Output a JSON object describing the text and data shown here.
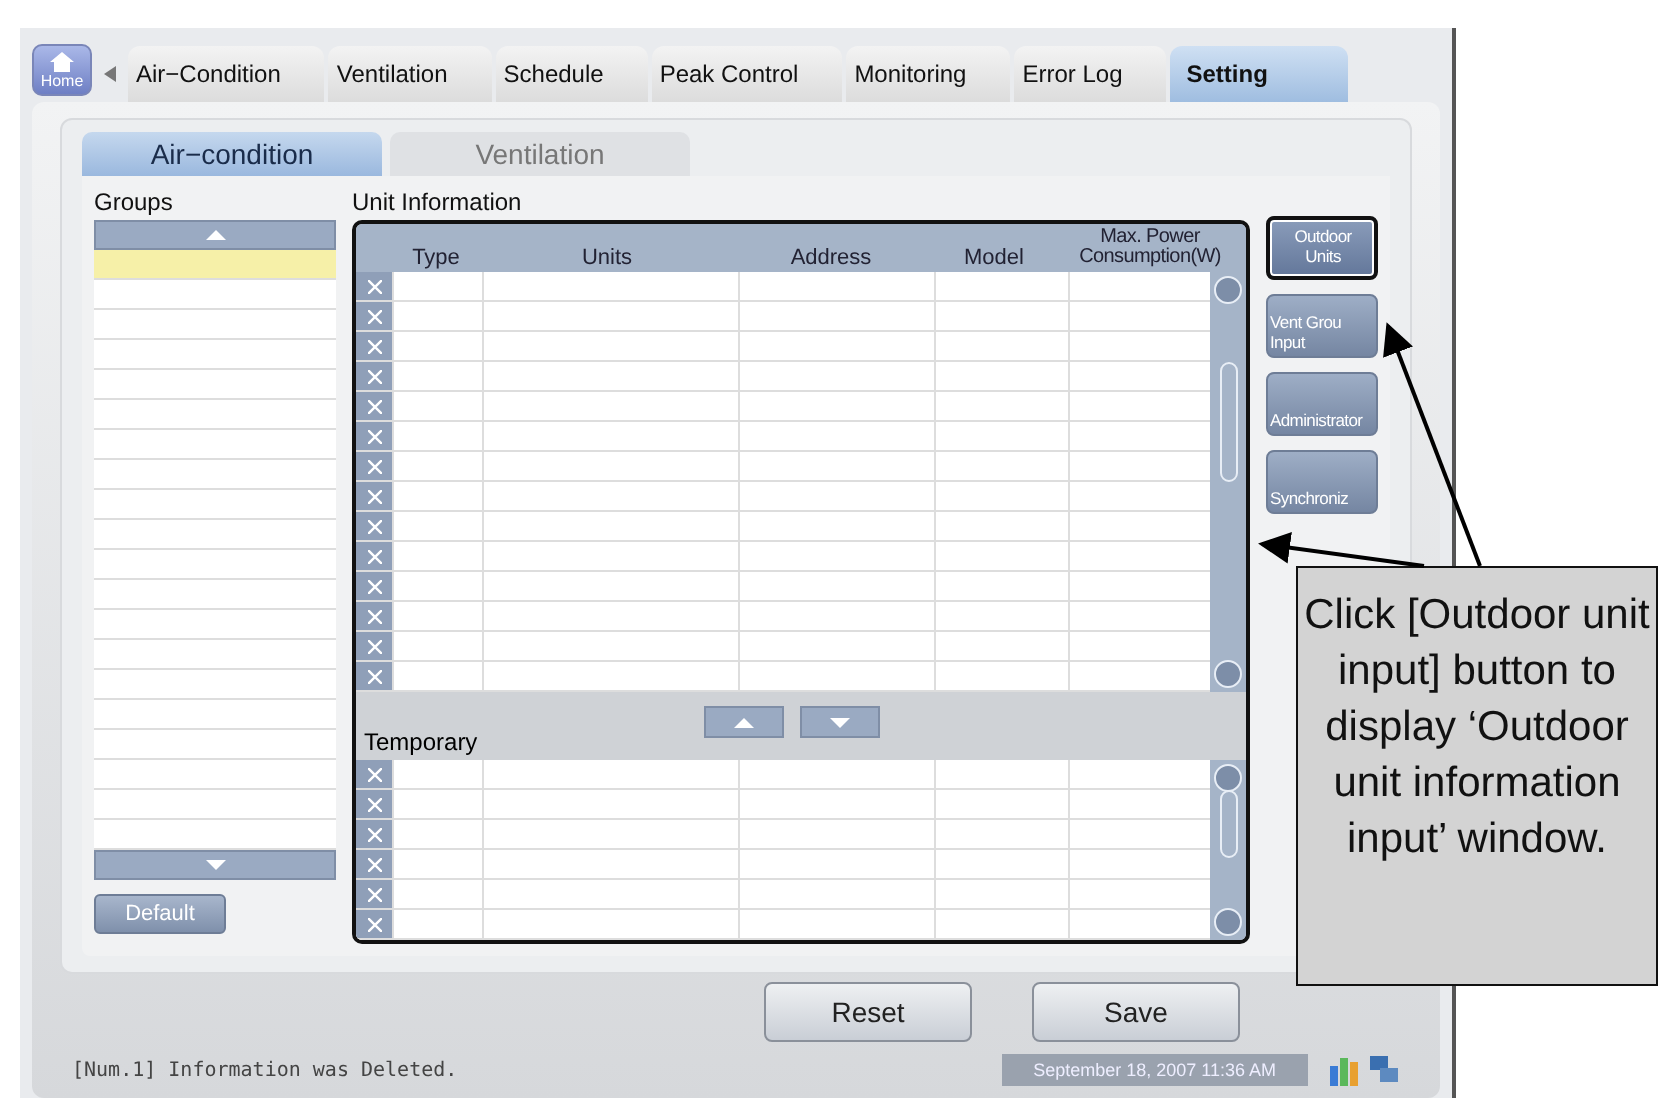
{
  "tabs": [
    {
      "label": "Home",
      "kind": "home",
      "selected": false
    },
    {
      "label": "Air−Condition",
      "kind": "tab",
      "selected": false
    },
    {
      "label": "Ventilation",
      "kind": "tab",
      "selected": false
    },
    {
      "label": "Schedule",
      "kind": "tab",
      "selected": false
    },
    {
      "label": "Peak Control",
      "kind": "tab",
      "selected": false
    },
    {
      "label": "Monitoring",
      "kind": "tab",
      "selected": false
    },
    {
      "label": "Error Log",
      "kind": "tab",
      "selected": false
    },
    {
      "label": "Setting",
      "kind": "tab",
      "selected": true
    }
  ],
  "subtabs": [
    {
      "label": "Air−condition",
      "selected": true
    },
    {
      "label": "Ventilation",
      "selected": false
    }
  ],
  "groups": {
    "title": "Groups",
    "button": "Default",
    "rows": [
      {
        "selected": true
      },
      {
        "selected": false
      },
      {
        "selected": false
      },
      {
        "selected": false
      },
      {
        "selected": false
      },
      {
        "selected": false
      },
      {
        "selected": false
      },
      {
        "selected": false
      },
      {
        "selected": false
      },
      {
        "selected": false
      },
      {
        "selected": false
      },
      {
        "selected": false
      },
      {
        "selected": false
      },
      {
        "selected": false
      },
      {
        "selected": false
      },
      {
        "selected": false
      },
      {
        "selected": false
      },
      {
        "selected": false
      },
      {
        "selected": false
      },
      {
        "selected": false
      }
    ]
  },
  "unit_information": {
    "title": "Unit Information",
    "columns": [
      "Type",
      "Units",
      "Address",
      "Model",
      "Max. Power Consumption(W)"
    ],
    "temporary_label": "Temporary"
  },
  "side_buttons": [
    {
      "lines": [
        "Outdoor",
        "Units"
      ],
      "highlighted": true
    },
    {
      "lines": [
        "Vent Grou",
        "Input"
      ],
      "highlighted": false
    },
    {
      "lines": [
        "Administrator"
      ],
      "highlighted": false
    },
    {
      "lines": [
        "Synchroniz"
      ],
      "highlighted": false
    }
  ],
  "actions": [
    "Reset",
    "Save"
  ],
  "status_bar": {
    "message": "[Num.1] Information was Deleted.",
    "datetime": "September 18, 2007 11:36 AM"
  },
  "callout": "Click [Outdoor unit input] button to display ‘Outdoor unit information input’ window."
}
